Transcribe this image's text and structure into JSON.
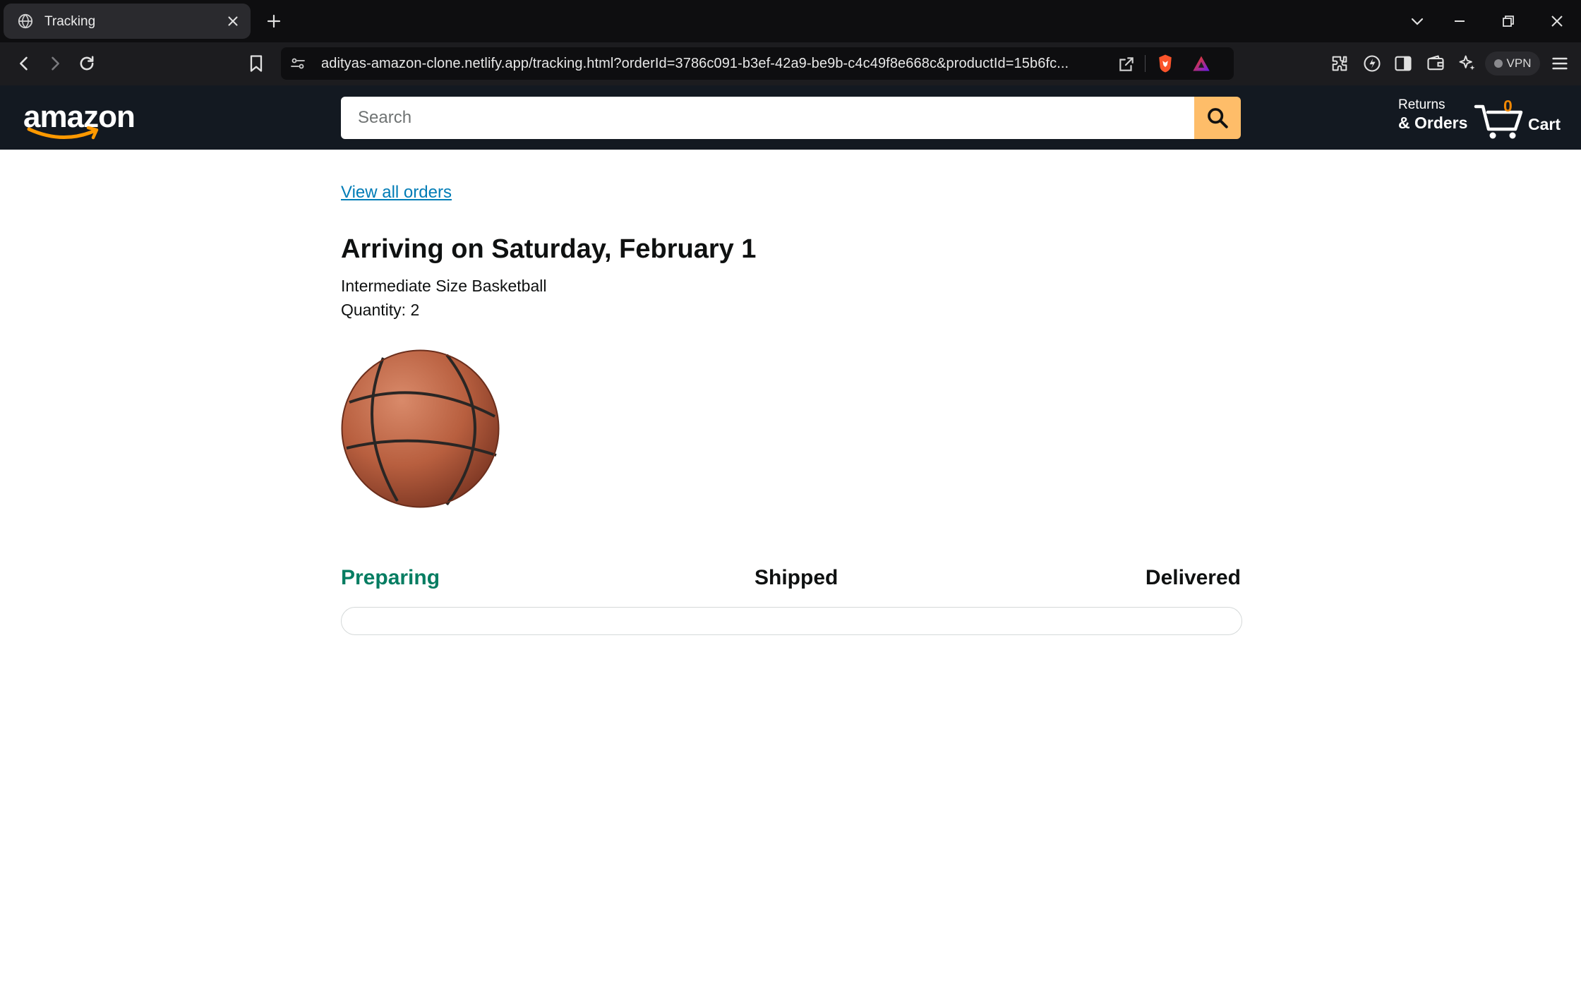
{
  "browser": {
    "tab_title": "Tracking",
    "url": "adityas-amazon-clone.netlify.app/tracking.html?orderId=3786c091-b3ef-42a9-be9b-c4c49f8e668c&productId=15b6fc...",
    "vpn_label": "VPN"
  },
  "header": {
    "logo_text": "amazon",
    "search_placeholder": "Search",
    "returns_line1": "Returns",
    "returns_line2": "& Orders",
    "cart_count": "0",
    "cart_label": "Cart"
  },
  "tracking": {
    "view_orders_link": "View all orders",
    "delivery_date": "Arriving on Saturday, February 1",
    "product_name": "Intermediate Size Basketball",
    "quantity_label": "Quantity: ",
    "quantity_value": "2",
    "steps": [
      "Preparing",
      "Shipped",
      "Delivered"
    ],
    "current_step": "Preparing",
    "progress_percent": 0
  },
  "colors": {
    "header_bg": "#131921",
    "search_button": "#febd69",
    "link": "#017cb6",
    "current_step": "#067d62",
    "cart_count": "#f08804"
  }
}
